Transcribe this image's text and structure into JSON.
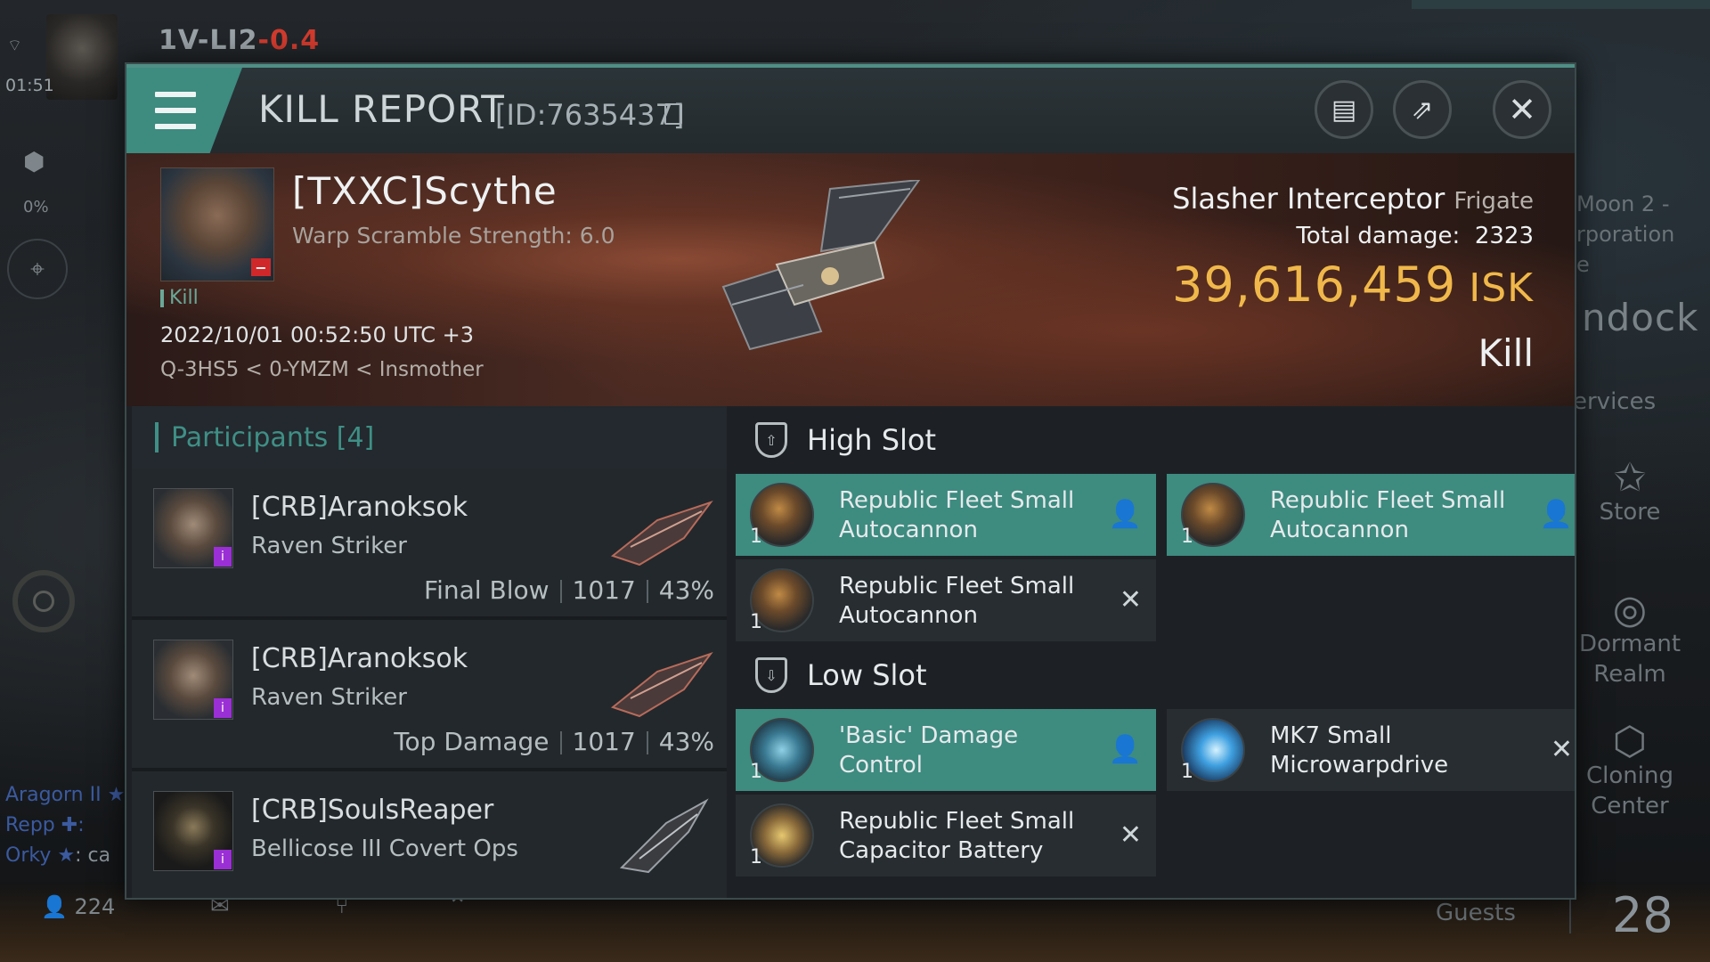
{
  "hud": {
    "system_name": "1V-LI2",
    "system_security": "-0.4",
    "time": "01:51",
    "cargo_percent": "0%",
    "player_count": "224",
    "chat": [
      {
        "name": "Aragorn II",
        "text": ""
      },
      {
        "name": "Repp",
        "text": ":"
      },
      {
        "name": "Orky",
        "text": ": ca"
      }
    ],
    "station_moon": "Moon 2 -",
    "station_corp": "rporation",
    "station_line3": "e",
    "undock_label": "ndock",
    "services_label": "ervices",
    "store_label": "Store",
    "dormant_label_1": "Dormant",
    "dormant_label_2": "Realm",
    "cloning_label_1": "Cloning",
    "cloning_label_2": "Center",
    "guests_label": "Guests",
    "guests_count": "28"
  },
  "window": {
    "title": "KILL REPORT",
    "report_id": "[ID:7635437]"
  },
  "victim": {
    "name": "[TXXC]Scythe",
    "warp_scramble": "Warp Scramble Strength: 6.0",
    "kill_tag": "Kill",
    "date": "2022/10/01 00:52:50 UTC +3",
    "location": "Q-3HS5 < 0-YMZM < Insmother",
    "ship_name": "Slasher Interceptor",
    "ship_class": "Frigate",
    "total_damage_label": "Total damage:",
    "total_damage": "2323",
    "isk_value": "39,616,459",
    "isk_unit": "ISK",
    "status": "Kill"
  },
  "participants": {
    "header": "Participants [4]",
    "rows": [
      {
        "name": "[CRB]Aranoksok",
        "ship": "Raven Striker",
        "role": "Final Blow",
        "damage": "1017",
        "percent": "43%"
      },
      {
        "name": "[CRB]Aranoksok",
        "ship": "Raven Striker",
        "role": "Top Damage",
        "damage": "1017",
        "percent": "43%"
      },
      {
        "name": "[CRB]SoulsReaper",
        "ship": "Bellicose III Covert Ops",
        "role": "",
        "damage": "",
        "percent": ""
      }
    ]
  },
  "fitting": {
    "high_slot_label": "High Slot",
    "low_slot_label": "Low Slot",
    "high": [
      {
        "name": "Republic Fleet Small Autocannon",
        "qty": "1",
        "status": "dropped"
      },
      {
        "name": "Republic Fleet Small Autocannon",
        "qty": "1",
        "status": "dropped"
      },
      {
        "name": "Republic Fleet Small Autocannon",
        "qty": "1",
        "status": "destroyed"
      }
    ],
    "low": [
      {
        "name": "'Basic' Damage Control",
        "qty": "1",
        "status": "dropped"
      },
      {
        "name": "MK7 Small Microwarpdrive",
        "qty": "1",
        "status": "destroyed"
      },
      {
        "name": "Republic Fleet Small Capacitor Battery",
        "qty": "1",
        "status": "destroyed"
      }
    ]
  },
  "colors": {
    "accent_teal": "#3e8b80",
    "isk_gold": "#f0b84a",
    "security_red": "#d23b2e",
    "badge_purple": "#9b2fd6"
  }
}
